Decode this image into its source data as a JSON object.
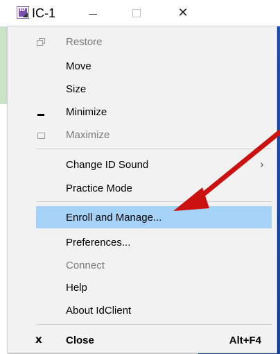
{
  "window": {
    "title": "IC-1",
    "controls": {
      "minimize": "—",
      "maximize": "□",
      "close": "✕"
    }
  },
  "menu": {
    "items": [
      {
        "label": "Restore",
        "enabled": false,
        "icon": "restore-icon"
      },
      {
        "label": "Move",
        "enabled": true
      },
      {
        "label": "Size",
        "enabled": true
      },
      {
        "label": "Minimize",
        "enabled": true,
        "icon": "minimize-icon"
      },
      {
        "label": "Maximize",
        "enabled": false,
        "icon": "maximize-icon"
      },
      {
        "label": "Change ID Sound",
        "enabled": true,
        "submenu": true,
        "submenu_glyph": "›"
      },
      {
        "label": "Practice Mode",
        "enabled": true
      },
      {
        "label": "Enroll and Manage...",
        "enabled": true,
        "highlighted": true
      },
      {
        "label": "Preferences...",
        "enabled": true
      },
      {
        "label": "Connect",
        "enabled": false
      },
      {
        "label": "Help",
        "enabled": true
      },
      {
        "label": "About IdClient",
        "enabled": true
      },
      {
        "label": "Close",
        "enabled": true,
        "icon": "close-x-icon",
        "icon_glyph": "x",
        "shortcut": "Alt+F4"
      }
    ]
  },
  "colors": {
    "highlight": "#a7d2f7",
    "arrow": "#cc1111",
    "desktop_blue": "#1f57c5"
  }
}
